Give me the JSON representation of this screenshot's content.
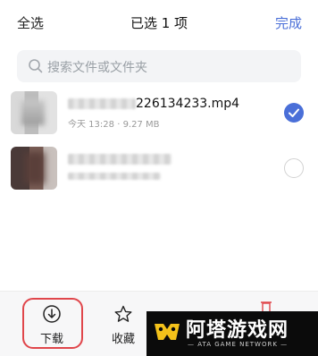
{
  "header": {
    "select_all": "全选",
    "title": "已选 1 项",
    "done": "完成"
  },
  "search": {
    "placeholder": "搜索文件或文件夹"
  },
  "files": [
    {
      "name_suffix": "226134233.mp4",
      "date": "今天 13:28",
      "separator": "·",
      "size": "9.27 MB",
      "selected": true
    },
    {
      "name_suffix": "",
      "date": "",
      "separator": "",
      "size": "",
      "selected": false
    }
  ],
  "toolbar": {
    "items": [
      {
        "label": "下载",
        "icon": "download-icon"
      },
      {
        "label": "收藏",
        "icon": "star-icon"
      }
    ]
  },
  "watermark": {
    "title": "阿塔游戏网",
    "subtitle": "— ATA GAME NETWORK —"
  },
  "colors": {
    "accent": "#4a6fd8",
    "highlight": "#e0464b",
    "delete_icon": "#e0464b"
  }
}
